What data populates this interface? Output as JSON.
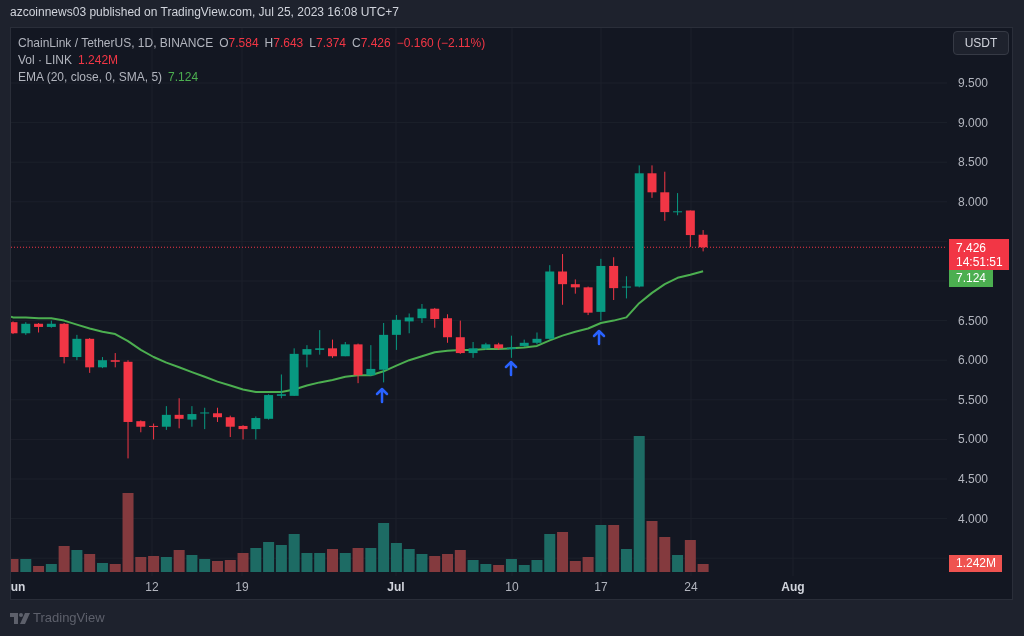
{
  "caption": "azcoinnews03 published on TradingView.com, Jul 25, 2023 16:08 UTC+7",
  "chart": {
    "last_bar_down": true,
    "legend": {
      "symbol": "ChainLink / TetherUS, 1D, BINANCE",
      "ohlc": [
        {
          "label": "O",
          "value": "7.584"
        },
        {
          "label": "H",
          "value": "7.643"
        },
        {
          "label": "L",
          "value": "7.374"
        },
        {
          "label": "C",
          "value": "7.426"
        }
      ],
      "change": "−0.160 (−2.11%)",
      "volume_label": "Vol · LINK",
      "volume_value": "1.242M",
      "indicator_label": "EMA (20, close, 0, SMA, 5)",
      "indicator_value": "7.124"
    },
    "currency_button": "USDT",
    "price_axis": {
      "labels": [
        "9.500",
        "9.000",
        "8.500",
        "8.000",
        "6.500",
        "6.000",
        "5.500",
        "5.000",
        "4.500",
        "4.000"
      ],
      "last_price": "7.426",
      "countdown": "14:51:51",
      "indicator_value": "7.124",
      "volume_value": "1.242M"
    },
    "time_axis": {
      "labels": [
        {
          "text": "un",
          "kind": "month"
        },
        {
          "text": "12",
          "kind": "day"
        },
        {
          "text": "19",
          "kind": "day"
        },
        {
          "text": "Jul",
          "kind": "month"
        },
        {
          "text": "10",
          "kind": "day"
        },
        {
          "text": "17",
          "kind": "day"
        },
        {
          "text": "24",
          "kind": "day"
        },
        {
          "text": "Aug",
          "kind": "month"
        }
      ]
    }
  },
  "footer": {
    "brand": "TradingView"
  }
}
